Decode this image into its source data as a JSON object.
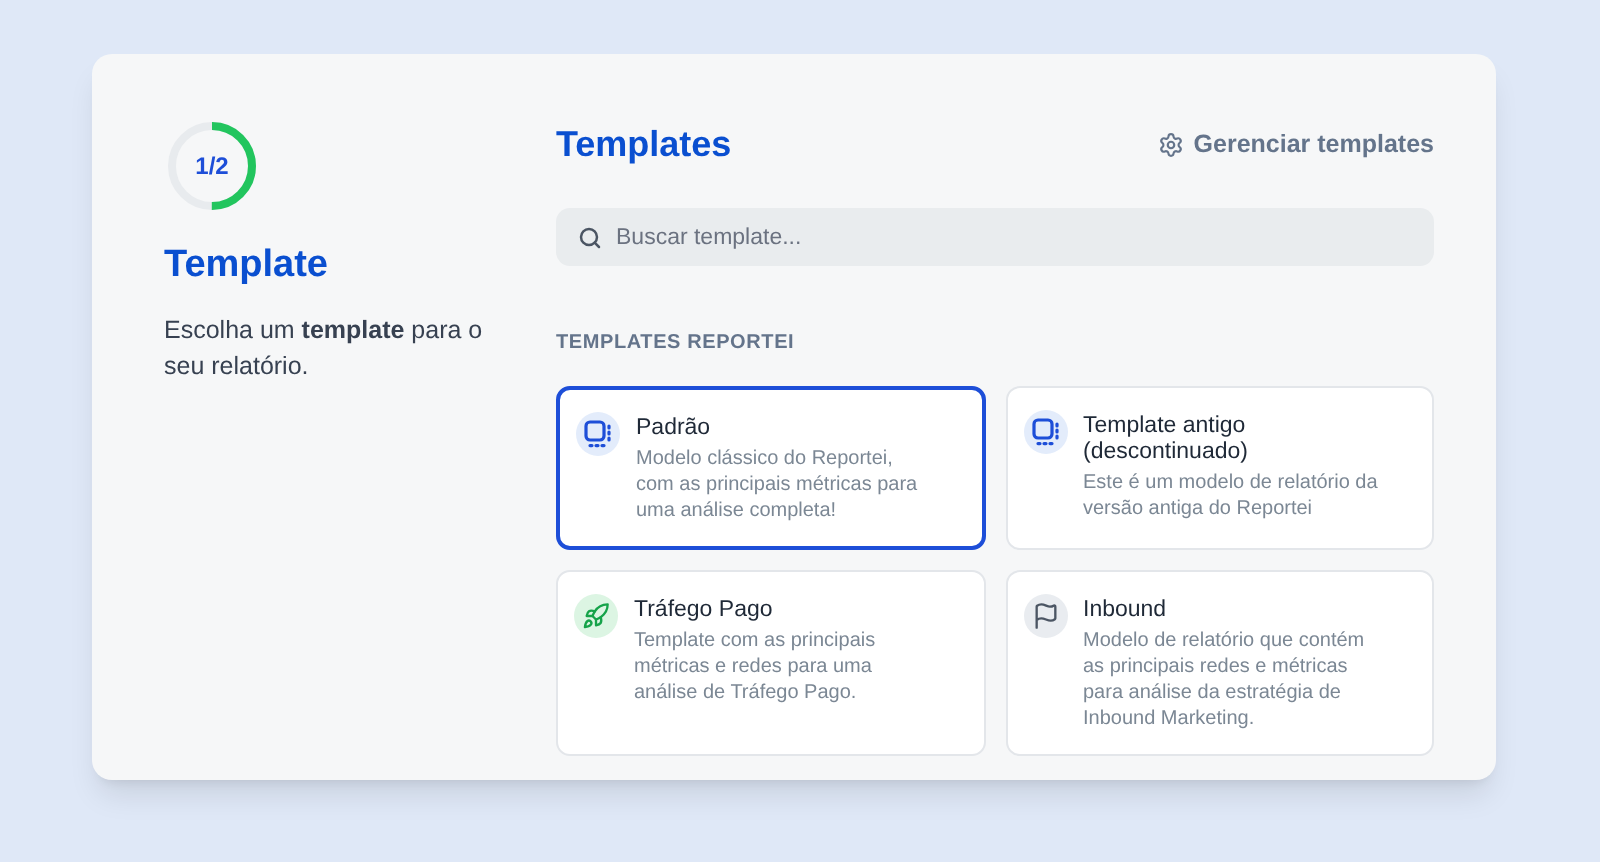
{
  "step": {
    "text": "1/2",
    "level": 0.5
  },
  "sidebar": {
    "title": "Template",
    "description": "Escolha um **template** para o seu relatório."
  },
  "header": {
    "title": "Templates",
    "manage_link": "Gerenciar templates"
  },
  "search": {
    "placeholder": "Buscar template..."
  },
  "section_title": "TEMPLATES REPORTEI",
  "templates": [
    {
      "kind": "layout",
      "title": "Padrão",
      "description": "Modelo clássico do Reportei, com as principais métricas para uma análise completa!",
      "selected": true
    },
    {
      "kind": "layout",
      "title": "Template antigo (descontinuado)",
      "description": "Este é um modelo de relatório da versão antiga do Reportei",
      "selected": false
    },
    {
      "kind": "rocket",
      "title": "Tráfego Pago",
      "description": "Template com as principais métricas e redes para uma análise de Tráfego Pago.",
      "selected": false
    },
    {
      "kind": "flag",
      "title": "Inbound",
      "description": "Modelo de relatório que contém as principais redes e métricas para análise da estratégia de Inbound Marketing.",
      "selected": false
    }
  ]
}
